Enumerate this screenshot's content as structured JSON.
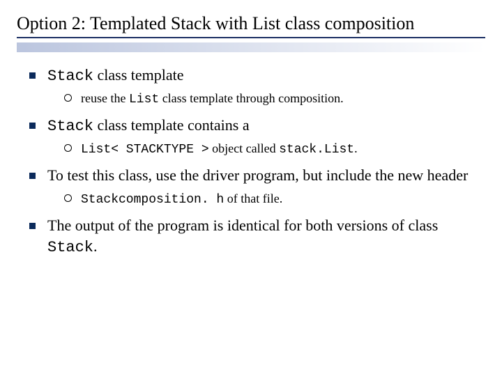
{
  "title": "Option 2: Templated Stack with List class composition",
  "items": [
    {
      "main_pre_code": "",
      "main_code": "Stack",
      "main_post_code": " class template",
      "sub": {
        "pre": "reuse the ",
        "code1": "List",
        "mid": " class template through composition.",
        "code2": "",
        "post": ""
      }
    },
    {
      "main_pre_code": "",
      "main_code": "Stack",
      "main_post_code": " class template contains a",
      "sub": {
        "pre": "",
        "code1": "List< STACKTYPE >",
        "mid": " object called ",
        "code2": "stack.List",
        "post": "."
      }
    },
    {
      "main_pre_code": "To test this class, use the driver program, but include the new header",
      "main_code": "",
      "main_post_code": "",
      "sub": {
        "pre": "",
        "code1": "Stackcomposition. h",
        "mid": " of that file.",
        "code2": "",
        "post": ""
      }
    },
    {
      "main_pre_code": "The output of the program is identical for both versions of class ",
      "main_code": "Stack",
      "main_post_code": ".",
      "sub": null
    }
  ]
}
